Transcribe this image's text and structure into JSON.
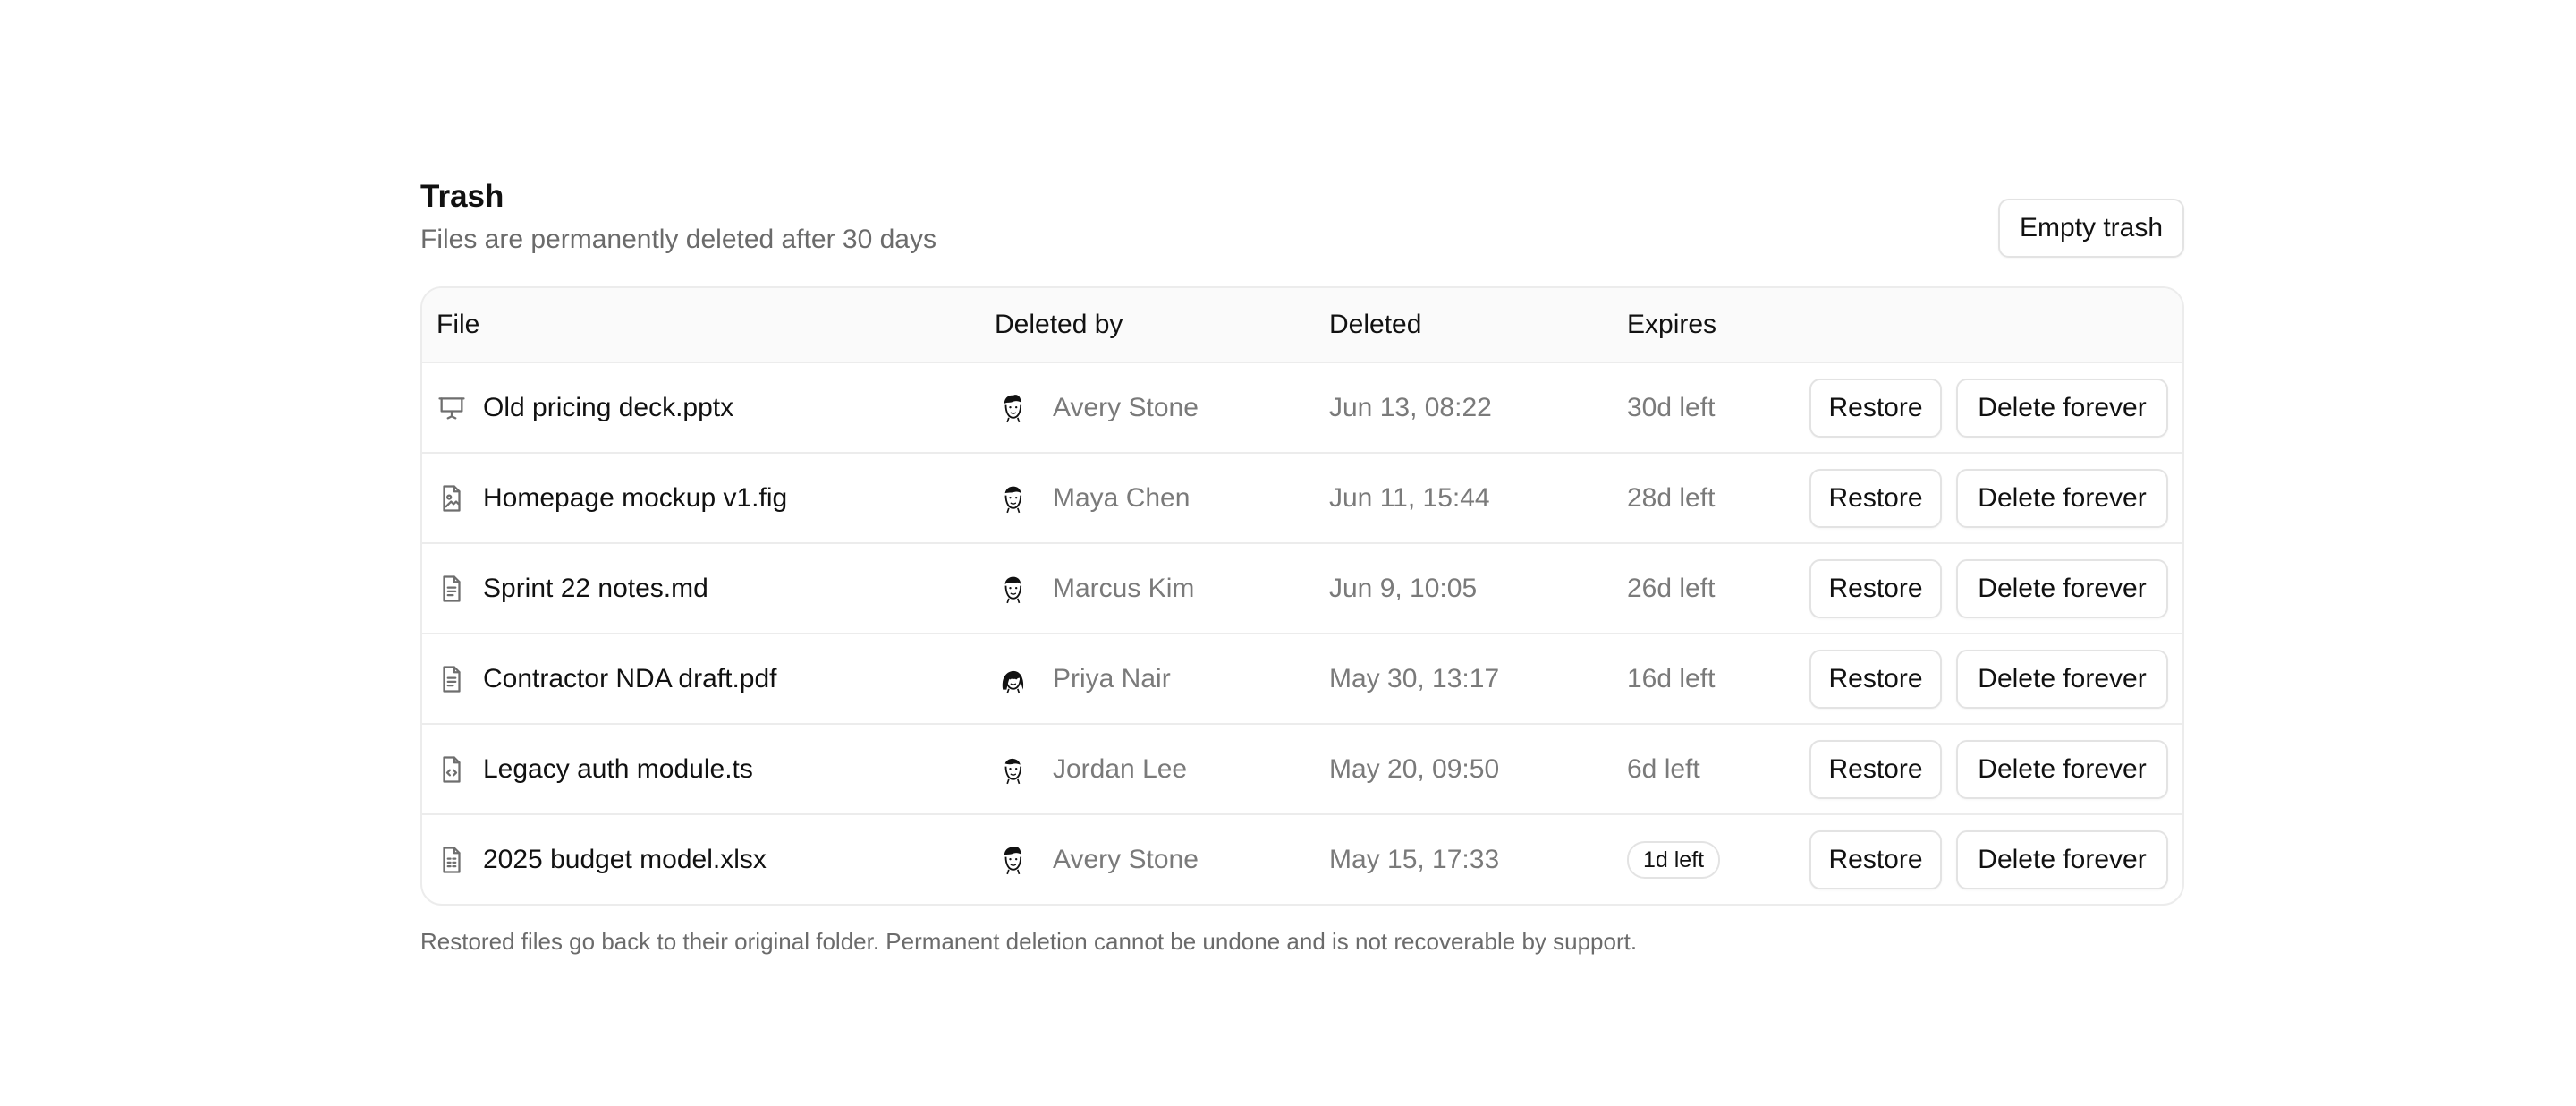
{
  "header": {
    "title": "Trash",
    "subtitle": "Files are permanently deleted after 30 days",
    "empty_button": "Empty trash"
  },
  "table": {
    "columns": [
      "File",
      "Deleted by",
      "Deleted",
      "Expires"
    ],
    "restore_label": "Restore",
    "delete_label": "Delete forever",
    "rows": [
      {
        "file": "Old pricing deck.pptx",
        "icon": "presentation-icon",
        "user": "Avery Stone",
        "deleted": "Jun 13, 08:22",
        "expires": "30d left",
        "urgent": false
      },
      {
        "file": "Homepage mockup v1.fig",
        "icon": "image-file-icon",
        "user": "Maya Chen",
        "deleted": "Jun 11, 15:44",
        "expires": "28d left",
        "urgent": false
      },
      {
        "file": "Sprint 22 notes.md",
        "icon": "text-file-icon",
        "user": "Marcus Kim",
        "deleted": "Jun 9, 10:05",
        "expires": "26d left",
        "urgent": false
      },
      {
        "file": "Contractor NDA draft.pdf",
        "icon": "text-file-icon",
        "user": "Priya Nair",
        "deleted": "May 30, 13:17",
        "expires": "16d left",
        "urgent": false
      },
      {
        "file": "Legacy auth module.ts",
        "icon": "code-file-icon",
        "user": "Jordan Lee",
        "deleted": "May 20, 09:50",
        "expires": "6d left",
        "urgent": false
      },
      {
        "file": "2025 budget model.xlsx",
        "icon": "spreadsheet-file-icon",
        "user": "Avery Stone",
        "deleted": "May 15, 17:33",
        "expires": "1d left",
        "urgent": true
      }
    ]
  },
  "footnote": "Restored files go back to their original folder. Permanent deletion cannot be undone and is not recoverable by support."
}
